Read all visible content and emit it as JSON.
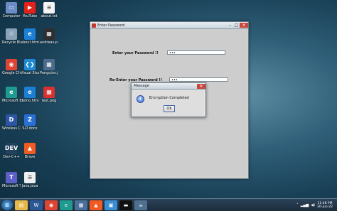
{
  "desktop_icons": [
    {
      "label": "Computer",
      "color": "#6b8cc4",
      "glyph": "▭"
    },
    {
      "label": "YouTube",
      "color": "#e62117",
      "glyph": "▶"
    },
    {
      "label": "about.txt",
      "color": "#f4f4f4",
      "glyph": "≡"
    },
    {
      "label": "Recycle Bin",
      "color": "#8aa2b8",
      "glyph": "♲"
    },
    {
      "label": "about.html",
      "color": "#1b7fd6",
      "glyph": "e"
    },
    {
      "label": "andreas-p...",
      "color": "#2e2e2e",
      "glyph": "▦"
    },
    {
      "label": "Google Chrome",
      "color": "#dd4433",
      "glyph": "◉"
    },
    {
      "label": "Visual Studio Code",
      "color": "#1f8ad2",
      "glyph": "❮❯"
    },
    {
      "label": "Penguins.jpg",
      "color": "#4d6b8a",
      "glyph": "▦"
    },
    {
      "label": "Microsoft Edge",
      "color": "#1f9a8f",
      "glyph": "e"
    },
    {
      "label": "demo.html",
      "color": "#1b7fd6",
      "glyph": "e"
    },
    {
      "label": "test.png",
      "color": "#d93030",
      "glyph": "▦"
    },
    {
      "label": "Wireless Connecti...",
      "color": "#2d55a3",
      "glyph": "D"
    },
    {
      "label": "SLT.docx",
      "color": "#2a6fd6",
      "glyph": "Z"
    },
    {
      "label": "Dev-C++",
      "color": "#23405f",
      "glyph": "DEV"
    },
    {
      "label": "Brave",
      "color": "#f25a21",
      "glyph": "▲"
    },
    {
      "label": "Microsoft Teams",
      "color": "#5b5fc7",
      "glyph": "T"
    },
    {
      "label": "Java.java",
      "color": "#efefef",
      "glyph": "≡"
    }
  ],
  "main_window": {
    "title": "Enter Password",
    "password_label": "Enter your Password !!",
    "password_value": "•••",
    "reenter_label": "Re-Enter your Password !!",
    "reenter_value": "•••"
  },
  "dialog": {
    "title": "Message",
    "message": "Encryption Completed",
    "ok_label": "OK"
  },
  "taskbar": {
    "items": [
      {
        "name": "taskbar-explorer",
        "glyph": "▤",
        "color": "#e6b84a"
      },
      {
        "name": "taskbar-word",
        "glyph": "W",
        "color": "#2b5797"
      },
      {
        "name": "taskbar-chrome",
        "glyph": "◉",
        "color": "#dd4433"
      },
      {
        "name": "taskbar-edge",
        "glyph": "e",
        "color": "#1f9a8f"
      },
      {
        "name": "taskbar-app",
        "glyph": "▦",
        "color": "#4a6f9a"
      },
      {
        "name": "taskbar-brave",
        "glyph": "▲",
        "color": "#f25a21"
      },
      {
        "name": "taskbar-store",
        "glyph": "▣",
        "color": "#3a8fd4"
      },
      {
        "name": "taskbar-cmd",
        "glyph": "▬",
        "color": "#111111"
      },
      {
        "name": "taskbar-java",
        "glyph": "☕",
        "color": "#4f6f8f"
      }
    ],
    "time": "11:48 PM",
    "date": "30-Jun-22"
  }
}
